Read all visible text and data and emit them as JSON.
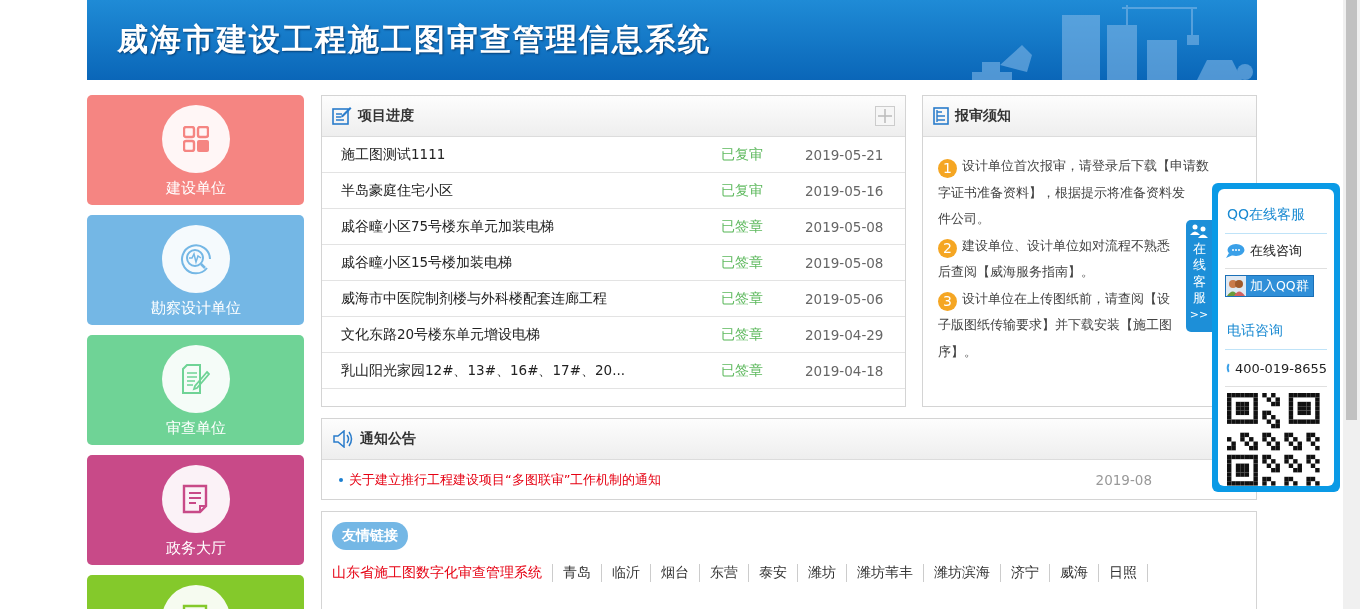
{
  "header": {
    "title": "威海市建设工程施工图审查管理信息系统"
  },
  "tiles": [
    {
      "label": "建设单位",
      "color": "#f58582",
      "kind": "grid"
    },
    {
      "label": "勘察设计单位",
      "color": "#74b7e5",
      "kind": "search"
    },
    {
      "label": "审查单位",
      "color": "#6fd396",
      "kind": "edit"
    },
    {
      "label": "政务大厅",
      "color": "#c84a88",
      "kind": "doc"
    },
    {
      "color": "#84c92b",
      "kind": "doc"
    }
  ],
  "projects": {
    "title": "项目进度",
    "rows": [
      {
        "name": "施工图测试1111",
        "status": "已复审",
        "date": "2019-05-21"
      },
      {
        "name": "半岛豪庭住宅小区",
        "status": "已复审",
        "date": "2019-05-16"
      },
      {
        "name": "戚谷疃小区75号楼东单元加装电梯",
        "status": "已签章",
        "date": "2019-05-08"
      },
      {
        "name": "戚谷疃小区15号楼加装电梯",
        "status": "已签章",
        "date": "2019-05-08"
      },
      {
        "name": "威海市中医院制剂楼与外科楼配套连廊工程",
        "status": "已签章",
        "date": "2019-05-06"
      },
      {
        "name": "文化东路20号楼东单元增设电梯",
        "status": "已签章",
        "date": "2019-04-29"
      },
      {
        "name": "乳山阳光家园12#、13#、16#、17#、20...",
        "status": "已签章",
        "date": "2019-04-18"
      }
    ]
  },
  "instructions": {
    "title": "报审须知",
    "items": [
      {
        "number": "1",
        "lines": [
          "设计单位首次报审，请登录后下载【申请数",
          "字证书准备资料】，根据提示将准备资料发",
          "件公司。"
        ]
      },
      {
        "number": "2",
        "lines": [
          "建设单位、设计单位如对流程不熟悉",
          "后查阅【威海服务指南】。"
        ]
      },
      {
        "number": "3",
        "lines": [
          "设计单位在上传图纸前，请查阅【设",
          "子版图纸传输要求】并下载安装【施工图",
          "序】。"
        ]
      }
    ]
  },
  "notices": {
    "title": "通知公告",
    "items": [
      {
        "text": "关于建立推行工程建设项目“多图联审”工作机制的通知",
        "date": "2019-08"
      }
    ]
  },
  "links": {
    "title": "友情链接",
    "items": [
      {
        "label": "山东省施工图数字化审查管理系统",
        "highlighted": true
      },
      {
        "label": "青岛",
        "highlighted": false
      },
      {
        "label": "临沂",
        "highlighted": false
      },
      {
        "label": "烟台",
        "highlighted": false
      },
      {
        "label": "东营",
        "highlighted": false
      },
      {
        "label": "泰安",
        "highlighted": false
      },
      {
        "label": "潍坊",
        "highlighted": false
      },
      {
        "label": "潍坊苇丰",
        "highlighted": false
      },
      {
        "label": "潍坊滨海",
        "highlighted": false
      },
      {
        "label": "济宁",
        "highlighted": false
      },
      {
        "label": "威海",
        "highlighted": false
      },
      {
        "label": "日照",
        "highlighted": false
      }
    ]
  },
  "service": {
    "tab_label": "在线客服",
    "tab_arrow": ">>",
    "qq_title": "QQ在线客服",
    "consult": "在线咨询",
    "join_group": "加入QQ群",
    "phone_title": "电话咨询",
    "phone": "400-019-8655"
  }
}
